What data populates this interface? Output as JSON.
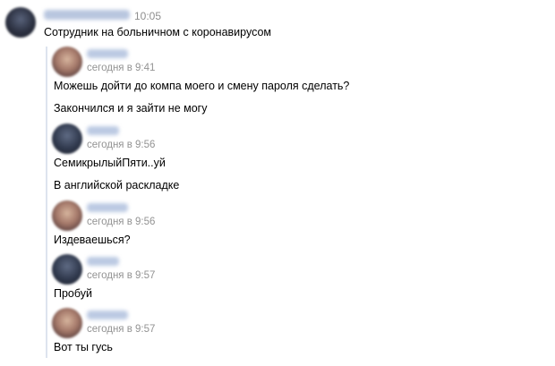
{
  "top_message": {
    "time": "10:05",
    "text": "Сотрудник на больничном с коронавирусом"
  },
  "forwarded_messages": [
    {
      "time": "сегодня в 9:41",
      "texts": [
        "Можешь дойти до компа моего и смену пароля сделать?",
        "Закончился и я зайти не могу"
      ]
    },
    {
      "time": "сегодня в 9:56",
      "texts": [
        "СемикрылыйПяти..уй",
        "В английской раскладке"
      ]
    },
    {
      "time": "сегодня в 9:56",
      "texts": [
        "Издеваешься?"
      ]
    },
    {
      "time": "сегодня в 9:57",
      "texts": [
        "Пробуй"
      ]
    },
    {
      "time": "сегодня в 9:57",
      "texts": [
        "Вот ты гусь"
      ]
    }
  ]
}
